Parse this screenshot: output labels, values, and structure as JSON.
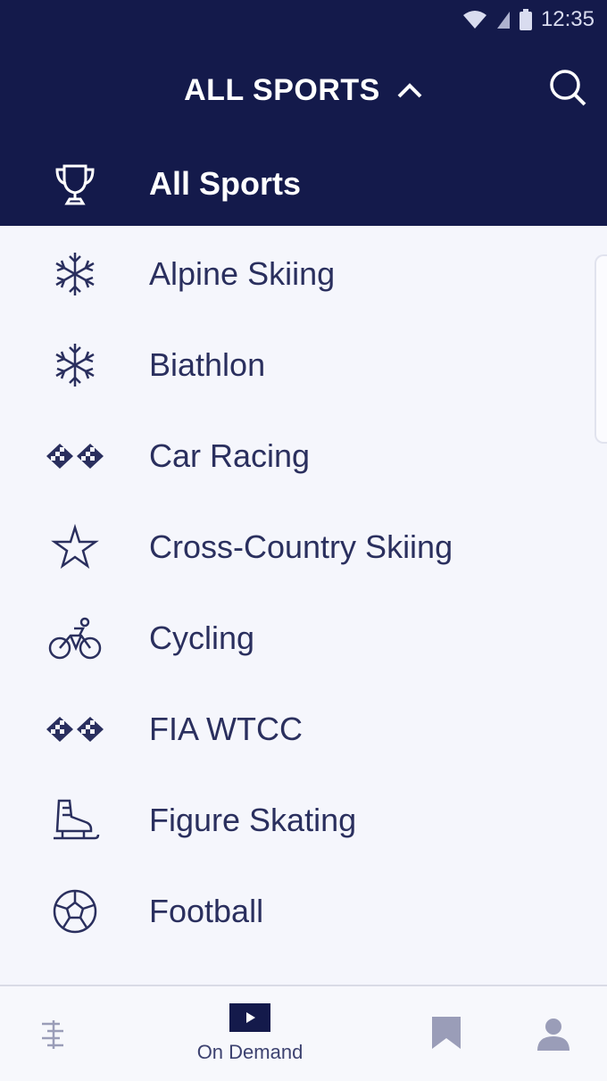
{
  "status_bar": {
    "time": "12:35"
  },
  "header": {
    "title": "ALL SPORTS"
  },
  "selected": {
    "label": "All Sports",
    "icon": "trophy-icon"
  },
  "sports": [
    {
      "label": "Alpine Skiing",
      "icon": "snowflake-icon"
    },
    {
      "label": "Biathlon",
      "icon": "snowflake-icon"
    },
    {
      "label": "Car Racing",
      "icon": "checkered-flags-icon"
    },
    {
      "label": "Cross-Country Skiing",
      "icon": "star-icon"
    },
    {
      "label": "Cycling",
      "icon": "bicycle-icon"
    },
    {
      "label": "FIA WTCC",
      "icon": "checkered-flags-icon"
    },
    {
      "label": "Figure Skating",
      "icon": "ice-skate-icon"
    },
    {
      "label": "Football",
      "icon": "soccer-ball-icon"
    }
  ],
  "bottom_nav": {
    "on_demand_label": "On Demand"
  },
  "colors": {
    "navy": "#141a4b",
    "text": "#2a2f5e"
  }
}
